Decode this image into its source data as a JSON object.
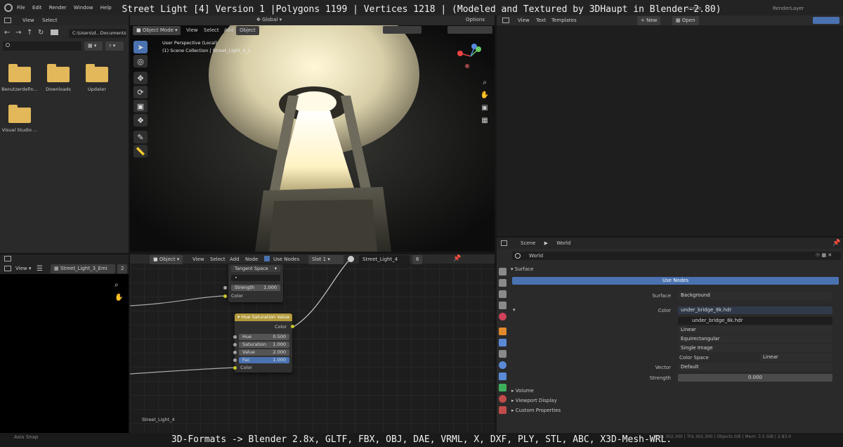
{
  "banner": {
    "title": "Street Light [4] Version 1 |Polygons 1199 | Vertices 1218 | (Modeled and Textured by 3DHaupt in Blender-2.80)",
    "footer": "3D-Formats -> Blender 2.8x, GLTF, FBX, OBJ, DAE, VRML, X, DXF, PLY, STL, ABC, X3D-Mesh-WRL."
  },
  "topbar": {
    "menus": [
      "File",
      "Edit",
      "Render",
      "Window",
      "Help"
    ],
    "scene": "Scene",
    "view_layer": "RenderLayer"
  },
  "file_browser": {
    "menus": [
      "View",
      "Select"
    ],
    "path": "C:\\Users\\d...Documents\\",
    "folders": [
      "Benutzerdefin...",
      "Downloads",
      "Updater",
      "Visual Studio ..."
    ]
  },
  "viewport": {
    "mode": "Object Mode",
    "menus": [
      "View",
      "Select",
      "Add",
      "Object"
    ],
    "orientation": "Global",
    "options_label": "Options",
    "info_line1": "User Perspective (Local)",
    "info_line2": "(1) Scene Collection | Street_Light_4_1"
  },
  "text_editor": {
    "menus": [
      "View",
      "Text",
      "Templates"
    ],
    "new_label": "New",
    "open_label": "Open"
  },
  "outliner_small": {
    "view_label": "View",
    "object_name": "Street_Light_3_Emi",
    "user_count": "2"
  },
  "node_editor": {
    "object_label": "Object",
    "menus": [
      "View",
      "Select",
      "Add",
      "Node"
    ],
    "use_nodes_label": "Use Nodes",
    "slot": "Slot 1",
    "material": "Street_Light_4",
    "material_users": "6",
    "frame_label": "Street_Light_4",
    "normal_node": {
      "space": "Tangent Space",
      "uv": "•",
      "strength_label": "Strength",
      "strength_value": "1.000",
      "color_label": "Color"
    },
    "hsv_node": {
      "title": "Hue Saturation Value",
      "output": "Color",
      "fields": [
        {
          "label": "Hue",
          "value": "0.500"
        },
        {
          "label": "Saturation",
          "value": "1.000"
        },
        {
          "label": "Value",
          "value": "2.000"
        },
        {
          "label": "Fac",
          "value": "1.000"
        }
      ],
      "input": "Color"
    }
  },
  "properties": {
    "breadcrumb_scene": "Scene",
    "breadcrumb_world": "World",
    "world_name": "World",
    "surface_panel": "Surface",
    "use_nodes_button": "Use Nodes",
    "surface_label": "Surface",
    "surface_value": "Background",
    "color_label": "Color",
    "color_value": "under_bridge_8k.hdr",
    "image_name": "under_bridge_8k.hdr",
    "interpolation": "Linear",
    "projection": "Equirectangular",
    "source": "Single Image",
    "color_space_label": "Color Space",
    "color_space_value": "Linear",
    "vector_label": "Vector",
    "vector_value": "Default",
    "strength_label": "Strength",
    "strength_value": "0.000",
    "panels": [
      "Volume",
      "Viewport Display",
      "Custom Properties"
    ]
  },
  "statusbar": {
    "left": "Axis Snap",
    "right": "Verts 302,300 | Tris 302,300 | Objects 0/6 | Mem: 3.5 GiB | 2.83.0"
  },
  "colors": {
    "accent": "#4a72b0",
    "node_header_hsv": "#b29a3c",
    "socket_color": "#c7c729",
    "socket_float": "#a1a1a1",
    "background": "#1d1d1d"
  }
}
